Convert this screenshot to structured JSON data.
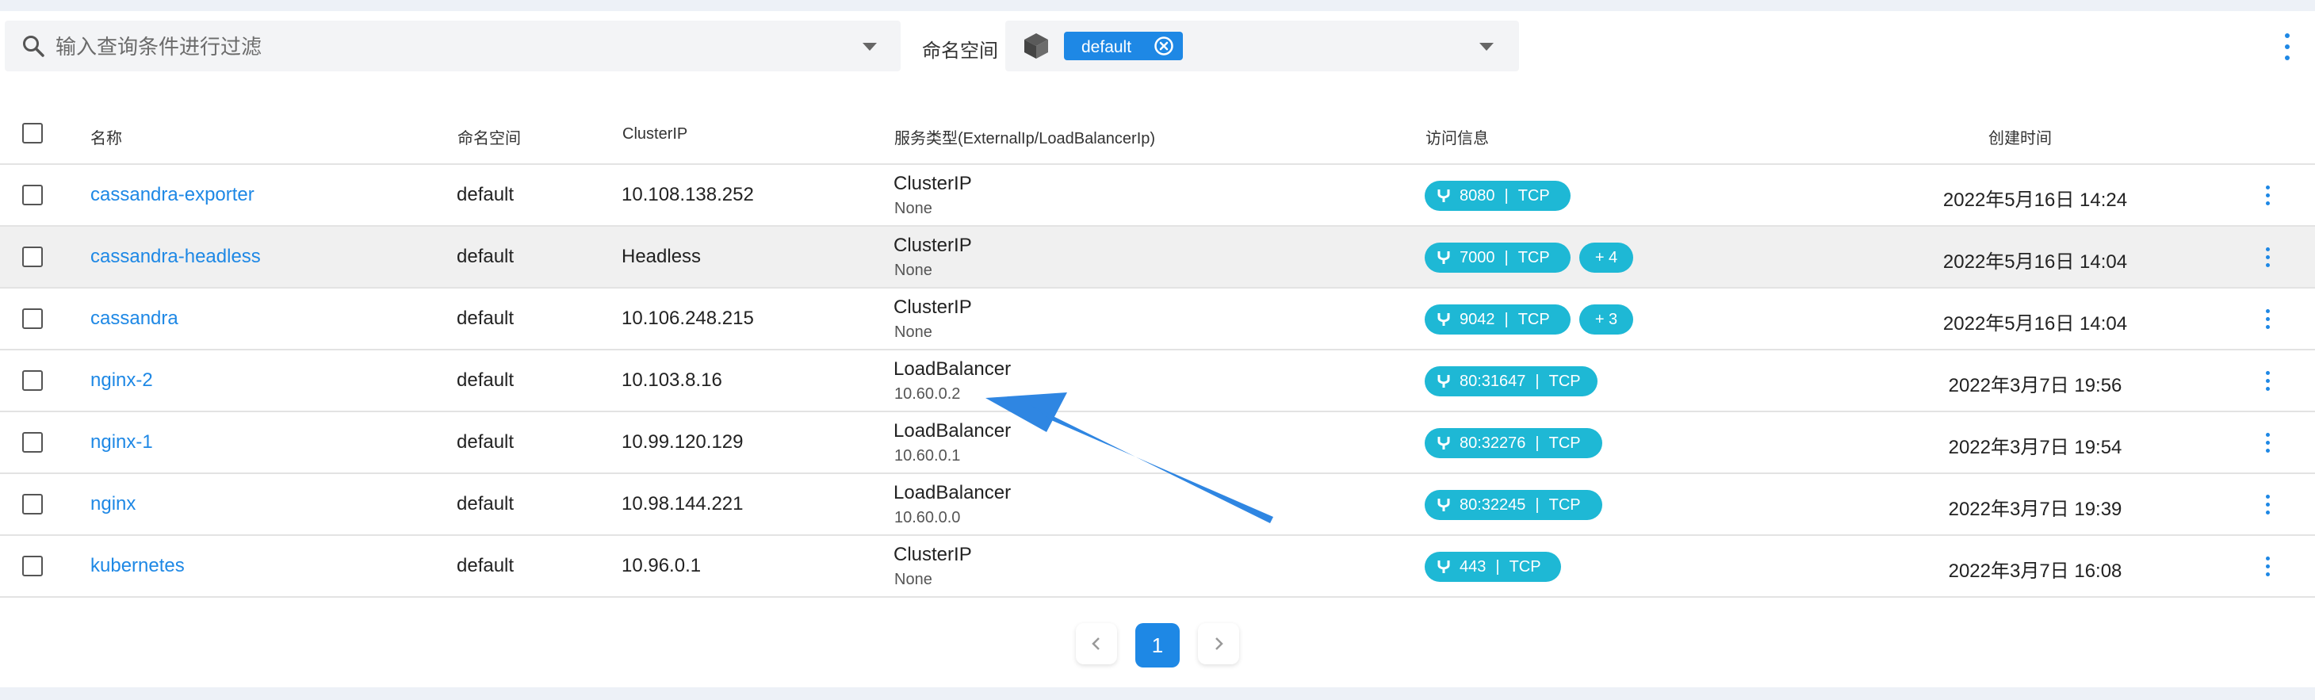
{
  "search": {
    "placeholder": "输入查询条件进行过滤"
  },
  "namespace_filter": {
    "label": "命名空间",
    "selected": "default"
  },
  "table": {
    "headers": {
      "name": "名称",
      "namespace": "命名空间",
      "cluster_ip": "ClusterIP",
      "service_type": "服务类型(ExternalIp/LoadBalancerIp)",
      "access": "访问信息",
      "created": "创建时间"
    },
    "rows": [
      {
        "name": "cassandra-exporter",
        "namespace": "default",
        "cluster_ip": "10.108.138.252",
        "type": "ClusterIP",
        "external": "None",
        "port": "8080",
        "protocol": "TCP",
        "more": "",
        "created": "2022年5月16日 14:24"
      },
      {
        "name": "cassandra-headless",
        "namespace": "default",
        "cluster_ip": "Headless",
        "type": "ClusterIP",
        "external": "None",
        "port": "7000",
        "protocol": "TCP",
        "more": "+ 4",
        "created": "2022年5月16日 14:04"
      },
      {
        "name": "cassandra",
        "namespace": "default",
        "cluster_ip": "10.106.248.215",
        "type": "ClusterIP",
        "external": "None",
        "port": "9042",
        "protocol": "TCP",
        "more": "+ 3",
        "created": "2022年5月16日 14:04"
      },
      {
        "name": "nginx-2",
        "namespace": "default",
        "cluster_ip": "10.103.8.16",
        "type": "LoadBalancer",
        "external": "10.60.0.2",
        "port": "80:31647",
        "protocol": "TCP",
        "more": "",
        "created": "2022年3月7日 19:56"
      },
      {
        "name": "nginx-1",
        "namespace": "default",
        "cluster_ip": "10.99.120.129",
        "type": "LoadBalancer",
        "external": "10.60.0.1",
        "port": "80:32276",
        "protocol": "TCP",
        "more": "",
        "created": "2022年3月7日 19:54"
      },
      {
        "name": "nginx",
        "namespace": "default",
        "cluster_ip": "10.98.144.221",
        "type": "LoadBalancer",
        "external": "10.60.0.0",
        "port": "80:32245",
        "protocol": "TCP",
        "more": "",
        "created": "2022年3月7日 19:39"
      },
      {
        "name": "kubernetes",
        "namespace": "default",
        "cluster_ip": "10.96.0.1",
        "type": "ClusterIP",
        "external": "None",
        "port": "443",
        "protocol": "TCP",
        "more": "",
        "created": "2022年3月7日 16:08"
      }
    ]
  },
  "pagination": {
    "current": "1"
  },
  "colors": {
    "primary": "#1e88e5",
    "pill": "#1eb8d5",
    "highlight_row": "#f0f0f0"
  },
  "icons": [
    "search-icon",
    "chevron-down-icon",
    "namespace-cube-icon",
    "close-circle-icon",
    "more-vertical-icon",
    "port-fork-icon",
    "chevron-left-icon",
    "chevron-right-icon"
  ]
}
